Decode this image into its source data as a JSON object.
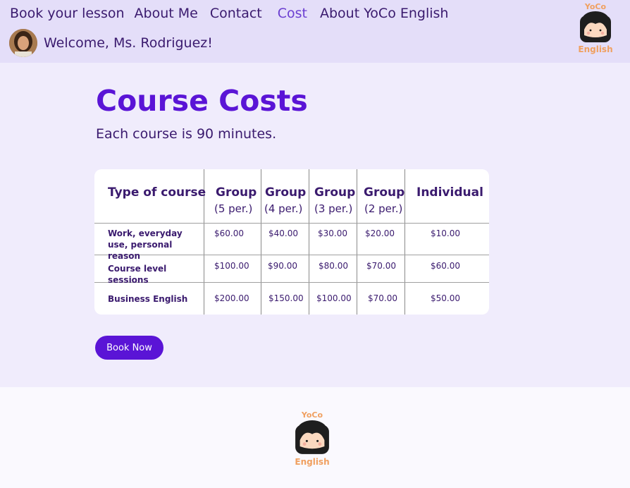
{
  "nav": {
    "items": [
      {
        "label": "Book your lesson",
        "active": false
      },
      {
        "label": "About Me",
        "active": false
      },
      {
        "label": "Contact",
        "active": false
      },
      {
        "label": "Cost",
        "active": true
      },
      {
        "label": "About YoCo English",
        "active": false
      }
    ]
  },
  "user": {
    "welcome": "Welcome, Ms. Rodriguez!"
  },
  "logo": {
    "top": "YoCo",
    "bottom": "English"
  },
  "page": {
    "title": "Course Costs",
    "subtitle": "Each course is 90 minutes."
  },
  "table": {
    "headers": [
      {
        "title": "Type of course",
        "sub": ""
      },
      {
        "title": "Group",
        "sub": "(5 per.)"
      },
      {
        "title": "Group",
        "sub": "(4 per.)"
      },
      {
        "title": "Group",
        "sub": "(3 per.)"
      },
      {
        "title": "Group",
        "sub": "(2 per.)"
      },
      {
        "title": "Individual",
        "sub": ""
      }
    ],
    "rows": [
      {
        "label": "Work, everyday use, personal reason",
        "prices": [
          "$60.00",
          "$40.00",
          "$30.00",
          "$20.00",
          "$10.00"
        ]
      },
      {
        "label": "Course level sessions",
        "prices": [
          "$100.00",
          "$90.00",
          "$80.00",
          "$70.00",
          "$60.00"
        ]
      },
      {
        "label": "Business English",
        "prices": [
          "$200.00",
          "$150.00",
          "$100.00",
          "$70.00",
          "$50.00"
        ]
      }
    ]
  },
  "cta": {
    "label": "Book Now"
  },
  "colors": {
    "accent": "#5a14d6",
    "active_nav": "#6b3fd1",
    "text": "#3a1a6e",
    "header_bg": "#e4def9",
    "body_bg": "#f0ecfc",
    "logo_orange": "#f0a060"
  }
}
